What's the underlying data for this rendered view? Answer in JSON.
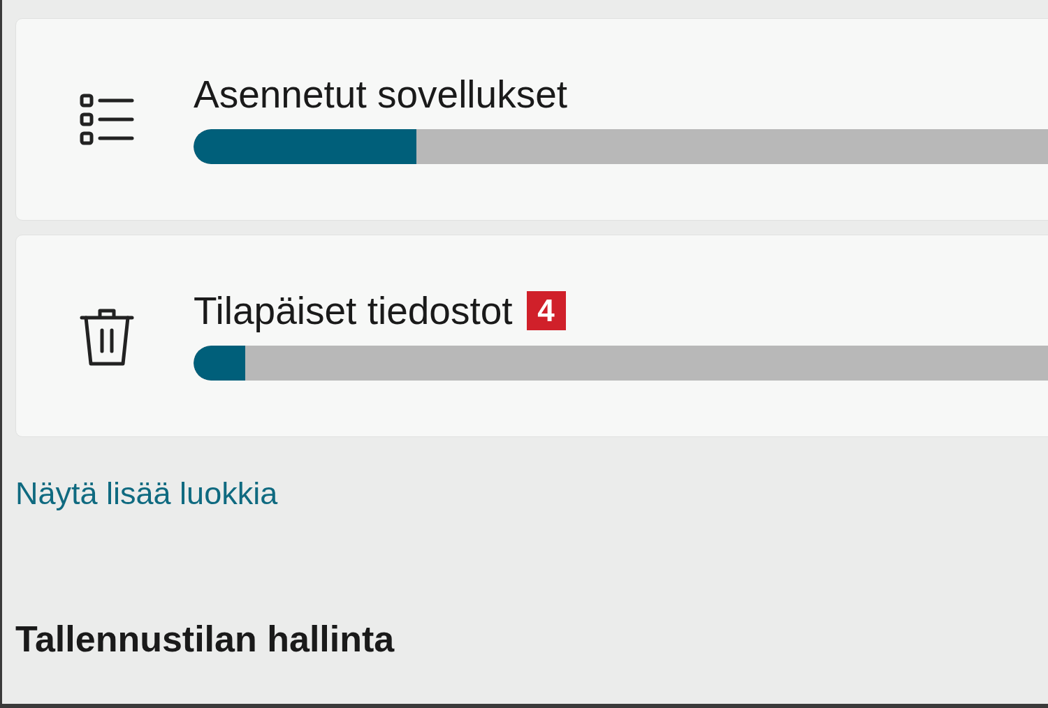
{
  "categories": [
    {
      "kind": "apps",
      "label": "Asennetut sovellukset",
      "level": 0.26
    },
    {
      "kind": "temp",
      "label": "Tilapäiset tiedostot",
      "badge": "4",
      "level": 0.06
    }
  ],
  "more_link": "Näytä lisää luokkia",
  "section_heading": "Tallennustilan hallinta"
}
